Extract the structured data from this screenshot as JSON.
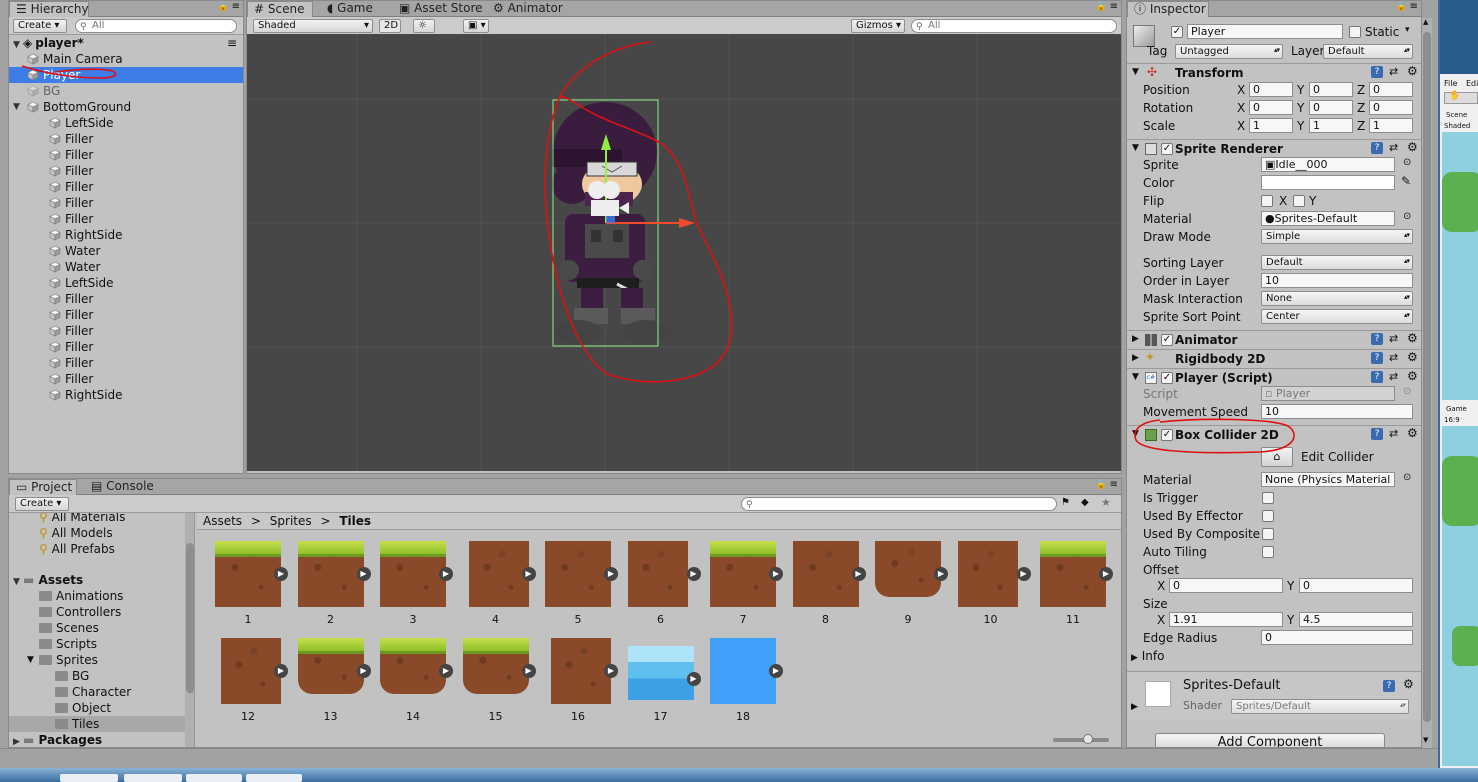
{
  "hierarchy": {
    "tab": "Hierarchy",
    "create": "Create",
    "search_placeholder": "All",
    "scene_name": "player*",
    "items": [
      "Main Camera",
      "Player",
      "BG",
      "BottomGround",
      "LeftSide",
      "Filler",
      "Filler",
      "Filler",
      "Filler",
      "Filler",
      "Filler",
      "RightSide",
      "Water",
      "Water",
      "LeftSide",
      "Filler",
      "Filler",
      "Filler",
      "Filler",
      "Filler",
      "Filler",
      "RightSide"
    ]
  },
  "scene_view": {
    "tabs": [
      "Scene",
      "Game",
      "Asset Store",
      "Animator"
    ],
    "shading": "Shaded",
    "mode_2d": "2D",
    "gizmos": "Gizmos",
    "search_placeholder": "All"
  },
  "inspector": {
    "tab": "Inspector",
    "object_name": "Player",
    "static_label": "Static",
    "tag_label": "Tag",
    "tag_value": "Untagged",
    "layer_label": "Layer",
    "layer_value": "Default",
    "transform": {
      "title": "Transform",
      "position_label": "Position",
      "position": [
        "0",
        "0",
        "0"
      ],
      "rotation_label": "Rotation",
      "rotation": [
        "0",
        "0",
        "0"
      ],
      "scale_label": "Scale",
      "scale": [
        "1",
        "1",
        "1"
      ]
    },
    "sprite_renderer": {
      "title": "Sprite Renderer",
      "sprite_label": "Sprite",
      "sprite_value": "Idle__000",
      "color_label": "Color",
      "flip_label": "Flip",
      "flip_x": "X",
      "flip_y": "Y",
      "material_label": "Material",
      "material_value": "Sprites-Default",
      "draw_mode_label": "Draw Mode",
      "draw_mode_value": "Simple",
      "sorting_layer_label": "Sorting Layer",
      "sorting_layer_value": "Default",
      "order_label": "Order in Layer",
      "order_value": "10",
      "mask_label": "Mask Interaction",
      "mask_value": "None",
      "sort_point_label": "Sprite Sort Point",
      "sort_point_value": "Center"
    },
    "animator": {
      "title": "Animator"
    },
    "rigidbody": {
      "title": "Rigidbody 2D"
    },
    "player_script": {
      "title": "Player (Script)",
      "script_label": "Script",
      "script_value": "Player",
      "speed_label": "Movement Speed",
      "speed_value": "10"
    },
    "box_collider": {
      "title": "Box Collider 2D",
      "edit_collider": "Edit Collider",
      "material_label": "Material",
      "material_value": "None (Physics Material",
      "is_trigger": "Is Trigger",
      "used_by_effector": "Used By Effector",
      "used_by_composite": "Used By Composite",
      "auto_tiling": "Auto Tiling",
      "offset_label": "Offset",
      "offset_x": "0",
      "offset_y": "0",
      "size_label": "Size",
      "size_x": "1.91",
      "size_y": "4.5",
      "edge_radius_label": "Edge Radius",
      "edge_radius_value": "0",
      "info_label": "Info"
    },
    "material_preview": {
      "name": "Sprites-Default",
      "shader_label": "Shader",
      "shader_value": "Sprites/Default"
    },
    "add_component": "Add Component"
  },
  "project": {
    "tabs": [
      "Project",
      "Console"
    ],
    "create": "Create",
    "favorites": [
      "All Materials",
      "All Models",
      "All Prefabs"
    ],
    "assets_label": "Assets",
    "folders": [
      "Animations",
      "Controllers",
      "Scenes",
      "Scripts",
      "Sprites"
    ],
    "sprite_folders": [
      "BG",
      "Character",
      "Object",
      "Tiles"
    ],
    "packages_label": "Packages",
    "breadcrumb": [
      "Assets",
      "Sprites",
      "Tiles"
    ],
    "tiles": [
      "1",
      "2",
      "3",
      "4",
      "5",
      "6",
      "7",
      "8",
      "9",
      "10",
      "11",
      "12",
      "13",
      "14",
      "15",
      "16",
      "17",
      "18"
    ]
  },
  "side_window": {
    "menu": [
      "File",
      "Edit"
    ],
    "scene_tab": "Scene",
    "shaded": "Shaded",
    "game_tab": "Game",
    "aspect": "16:9"
  },
  "colors": {
    "selection": "#3e7de7",
    "scene_bg": "#474747",
    "annotation": "#e01010"
  }
}
